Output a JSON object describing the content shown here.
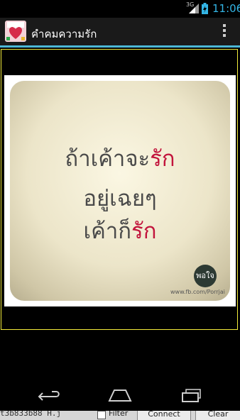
{
  "status_bar": {
    "network": "3G",
    "time": "11:06"
  },
  "action_bar": {
    "title": "คำคมความรัก",
    "app_icon": "app-logo-icon",
    "menu_icon": "overflow-menu-icon"
  },
  "quote": {
    "line1_a": "ถ้าเค้าจะ",
    "line1_b": "รัก",
    "line2": "อยู่เฉยๆ",
    "line3_a": "เค้าก็",
    "line3_b": "รัก",
    "logo_text": "พอใจ",
    "url": "www.fb.com/Porrjai"
  },
  "nav_bar": {
    "back": "back-icon",
    "home": "home-icon",
    "recent": "recent-apps-icon"
  },
  "debug_strip": {
    "text": "t3b833b88 H.j",
    "filter_label": "Filter",
    "connect_label": "Connect",
    "clear_label": "Clear"
  },
  "colors": {
    "accent": "#33b5e5",
    "frame": "#f2ea3a",
    "quote_red": "#c2143c"
  }
}
